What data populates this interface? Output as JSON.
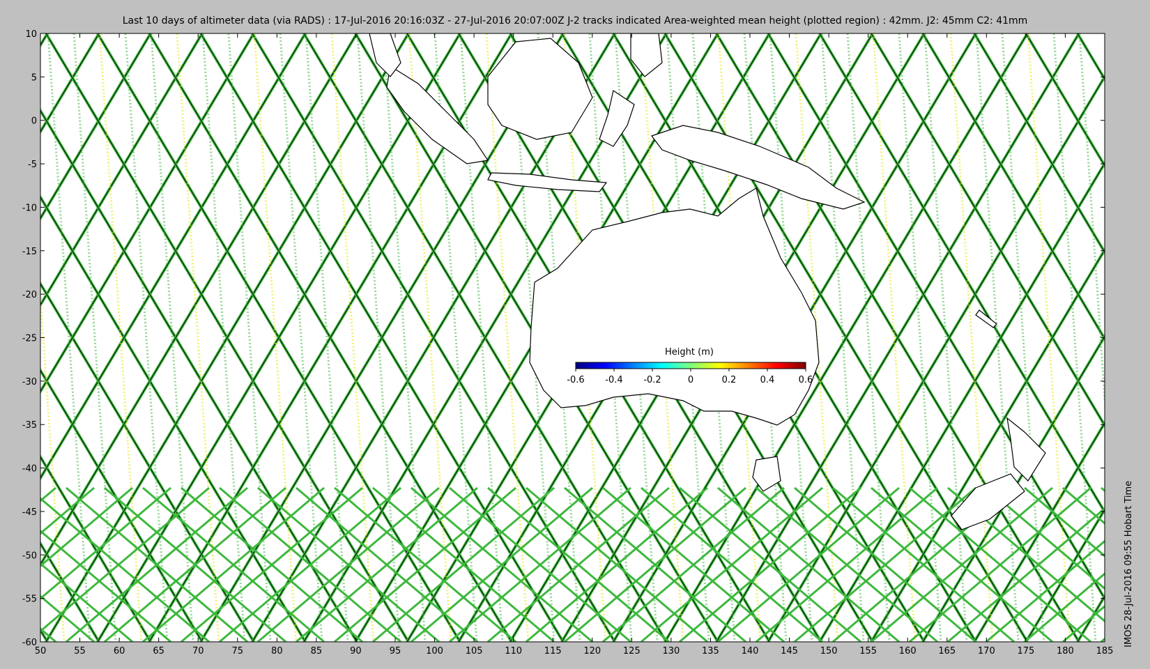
{
  "title": "Last 10 days of altimeter data (via RADS) : 17-Jul-2016 20:16:03Z - 27-Jul-2016 20:07:00Z  J-2 tracks indicated  Area-weighted mean height (plotted region) : 42mm.  J2: 45mm  C2: 41mm",
  "footer": "IMOS 28-Jul-2016 09:55 Hobart Time",
  "map": {
    "lon_range": [
      50,
      185
    ],
    "lat_range": [
      -60,
      10
    ],
    "lon_ticks": [
      "50",
      "55",
      "60",
      "65",
      "70",
      "75",
      "80",
      "85",
      "90",
      "95",
      "100",
      "105",
      "110",
      "115",
      "120",
      "125",
      "130",
      "135",
      "140",
      "145",
      "150",
      "155",
      "160",
      "165",
      "170",
      "175",
      "180",
      "185"
    ],
    "lat_ticks": [
      "10",
      "5",
      "0",
      "-5",
      "-10",
      "-15",
      "-20",
      "-25",
      "-30",
      "-35",
      "-40",
      "-45",
      "-50",
      "-55",
      "-60"
    ]
  },
  "colorbar": {
    "title": "Height (m)",
    "ticks": [
      "-0.6",
      "-0.4",
      "-0.2",
      "0",
      "0.2",
      "0.4",
      "0.6"
    ],
    "colors": [
      "#00007f",
      "#0000ff",
      "#007fff",
      "#00ffff",
      "#7fff7f",
      "#ffff00",
      "#ff7f00",
      "#ff0000",
      "#7f0000"
    ]
  },
  "colors": {
    "background": "#c0c0c0",
    "map": "#ffffff",
    "track_green": "#3db83d",
    "track_line": "#000000",
    "track_yellow": "#e6e600"
  }
}
